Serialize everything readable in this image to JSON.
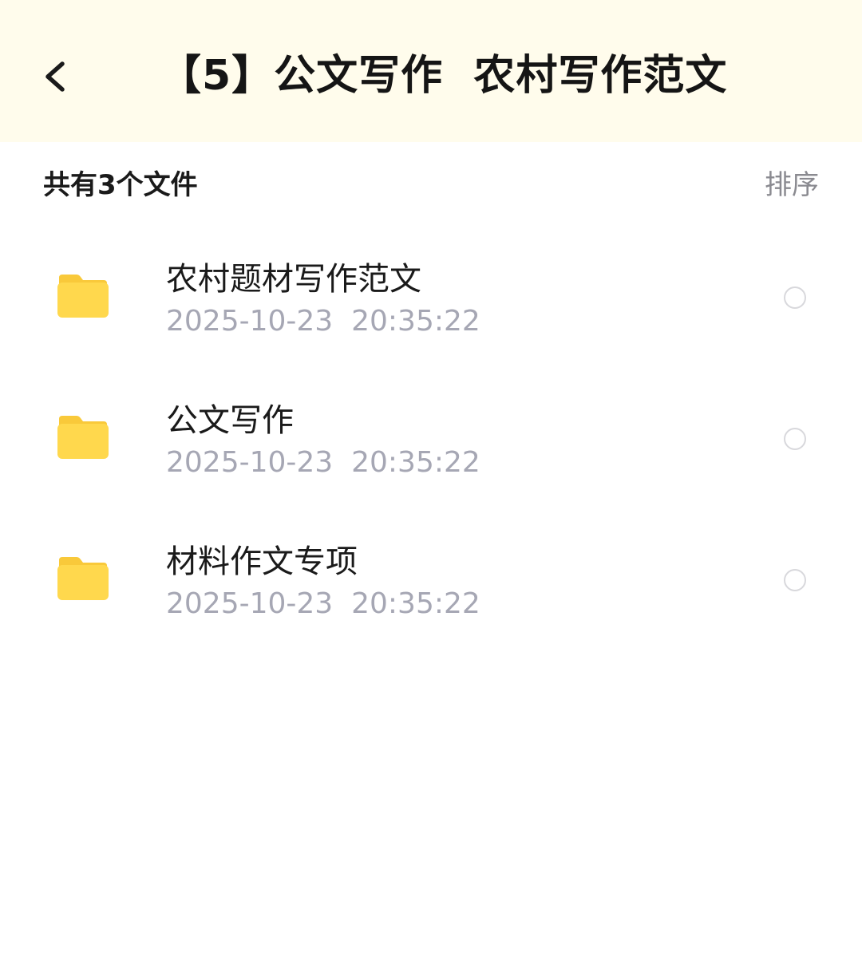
{
  "header": {
    "title": "【5】公文写作  农村写作范文",
    "back_icon": "chevron-left-icon",
    "background": "#fffcec"
  },
  "summary": {
    "file_count_label": "共有3个文件",
    "sort_label": "排序"
  },
  "files": [
    {
      "name": "农村题材写作范文",
      "date": "2025-10-23  20:35:22",
      "icon": "folder-icon"
    },
    {
      "name": "公文写作",
      "date": "2025-10-23  20:35:22",
      "icon": "folder-icon"
    },
    {
      "name": "材料作文专项",
      "date": "2025-10-23  20:35:22",
      "icon": "folder-icon"
    }
  ],
  "colors": {
    "folder": "#ffd84d",
    "folder_tab": "#f9c93a",
    "date_text": "#a6a7b4",
    "sort_text": "#8a8a90"
  }
}
